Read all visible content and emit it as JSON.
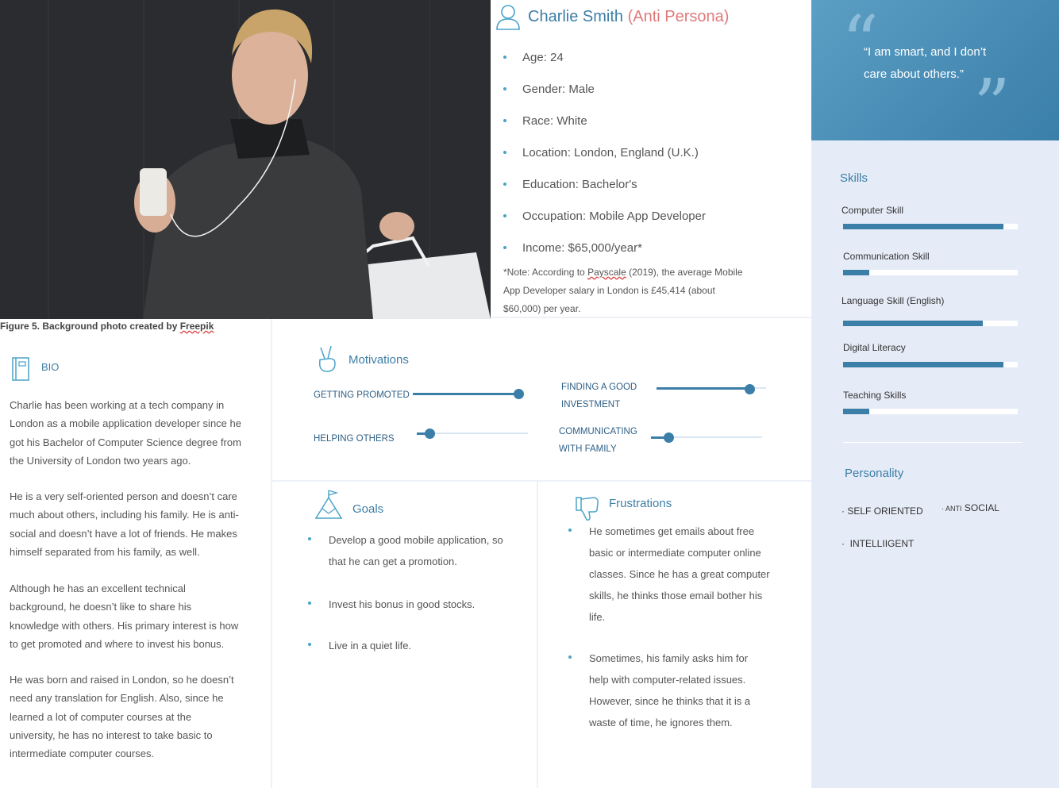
{
  "photo": {
    "caption_prefix": "Figure 5. Background photo created by ",
    "caption_source": "Freepik"
  },
  "persona": {
    "name": "Charlie Smith",
    "tag": "(Anti Persona)",
    "facts": [
      "Age: 24",
      "Gender: Male",
      "Race: White",
      "Location: London, England (U.K.)",
      "Education: Bachelor's",
      "Occupation: Mobile App Developer",
      "Income: $65,000/year*"
    ],
    "note_prefix": "*Note: According to ",
    "note_source": "Payscale",
    "note_line1_rest": " (2019), the average Mobile",
    "note_line2": "App Developer  salary in London is £45,414 (about",
    "note_line3": "$60,000) per year."
  },
  "quote": {
    "line1": "“I am smart, and I don’t",
    "line2": "care about others.”",
    "open_mark": "“",
    "close_mark": "”"
  },
  "skills": {
    "title": "Skills",
    "items": [
      {
        "label": "Computer Skill",
        "level": 0.92
      },
      {
        "label": "Communication Skill",
        "level": 0.15
      },
      {
        "label": "Language Skill (English)",
        "level": 0.8
      },
      {
        "label": "Digital Literacy",
        "level": 0.92
      },
      {
        "label": "Teaching Skills",
        "level": 0.15
      }
    ],
    "color": "#3b7ea8"
  },
  "personality": {
    "title": "Personality",
    "traits": [
      "SELF ORIENTED",
      "ANTI",
      "SOCIAL",
      "INTELLIIGENT"
    ]
  },
  "bio": {
    "title": "BIO",
    "paragraphs": [
      [
        "Charlie has been working at a tech company in",
        "London as a mobile application developer since he",
        "got his Bachelor of Computer Science degree from",
        "the University of London two years ago."
      ],
      [
        "He is a very self-oriented person and doesn’t care",
        "much about others, including his family. He is anti-",
        "social and doesn’t have a lot of friends. He makes",
        "himself separated from his family, as well."
      ],
      [
        "Although he has an excellent technical",
        "background, he doesn’t like to share his",
        "knowledge with others. His primary interest is how",
        "to get promoted and where to invest his bonus."
      ],
      [
        "He was born and raised in London, so he doesn’t",
        "need any translation for English. Also, since he",
        "learned a lot of computer courses at the",
        "university, he has no interest to take basic to",
        "intermediate computer courses."
      ]
    ]
  },
  "motivations": {
    "title": "Motivations",
    "items": [
      {
        "label_lines": [
          "GETTING PROMOTED"
        ],
        "level": 0.95
      },
      {
        "label_lines": [
          "FINDING A GOOD",
          "INVESTMENT"
        ],
        "level": 0.85
      },
      {
        "label_lines": [
          "HELPING OTHERS"
        ],
        "level": 0.12
      },
      {
        "label_lines": [
          "COMMUNICATING",
          "WITH FAMILY"
        ],
        "level": 0.16
      }
    ]
  },
  "goals": {
    "title": "Goals",
    "items": [
      [
        "Develop a good mobile application, so",
        "that he can get a promotion."
      ],
      [
        "Invest his bonus in good stocks."
      ],
      [
        "Live in a quiet life."
      ]
    ]
  },
  "frustrations": {
    "title": "Frustrations",
    "items": [
      [
        "He sometimes get emails about free",
        "basic or intermediate computer online",
        "classes. Since he has a great computer",
        "skills, he thinks those email bother his",
        "life."
      ],
      [
        "Sometimes, his family asks him for",
        "help with computer-related issues.",
        "However, since he thinks that it is a",
        "waste of time, he ignores them."
      ]
    ]
  }
}
